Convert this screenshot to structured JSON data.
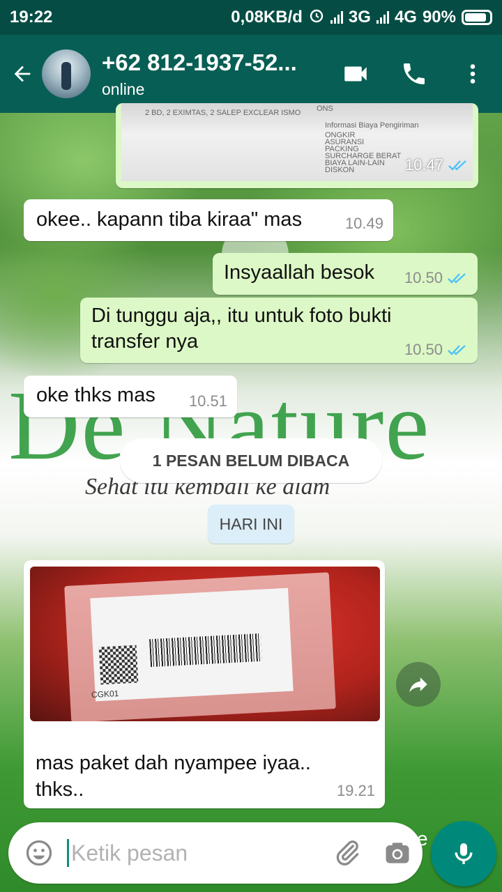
{
  "status_bar": {
    "time": "19:22",
    "network_speed": "0,08KB/d",
    "net1": "3G",
    "net2": "4G",
    "battery": "90%"
  },
  "header": {
    "contact_name": "+62 812-1937-52...",
    "presence": "online",
    "icons": [
      "back-arrow-icon",
      "video-call-icon",
      "phone-icon",
      "more-vert-icon"
    ]
  },
  "wallpaper": {
    "brand": "De Nature",
    "tagline": "Sehat itu kembali ke alam",
    "corner_text": "e ... awa"
  },
  "top_image": {
    "time": "10.47",
    "receipt_lines": [
      "2 BD, 2 EXIMTAS, 2 SALEP EXCLEAR ISMO",
      "ONS",
      "Informasi Biaya Pengiriman",
      "ONGKIR",
      "ASURANSI",
      "PACKING",
      "SURCHARGE BERAT",
      "BIAYA LAIN-LAIN",
      "DISKON"
    ]
  },
  "messages": [
    {
      "dir": "in",
      "text": "okee.. kapann tiba kiraa\" mas",
      "time": "10.49"
    },
    {
      "dir": "out",
      "text": "Insyaallah besok",
      "time": "10.50"
    },
    {
      "dir": "out",
      "text": "Di tunggu aja,, itu untuk foto bukti transfer nya",
      "time": "10.50"
    },
    {
      "dir": "in",
      "text": "oke thks mas",
      "time": "10.51"
    }
  ],
  "unread_banner": "1 PESAN BELUM DIBACA",
  "date_divider": "HARI INI",
  "image_message": {
    "caption": "mas paket dah nyampee iyaa.. thks..",
    "time": "19.21",
    "photo_label": "CGK01"
  },
  "composer": {
    "placeholder": "Ketik pesan"
  },
  "colors": {
    "header": "#075e54",
    "statusbar": "#054d44",
    "outgoing_bubble": "#dcf8c6",
    "incoming_bubble": "#ffffff",
    "read_ticks": "#4fc3f7",
    "mic_button": "#00897b"
  }
}
